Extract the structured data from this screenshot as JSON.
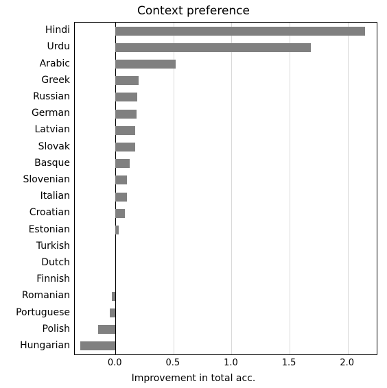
{
  "chart_data": {
    "type": "bar",
    "orientation": "horizontal",
    "title": "Context preference",
    "xlabel": "Improvement in total acc.",
    "ylabel": "",
    "xlim": [
      -0.35,
      2.25
    ],
    "xticks": [
      0.0,
      0.5,
      1.0,
      1.5,
      2.0
    ],
    "categories": [
      "Hindi",
      "Urdu",
      "Arabic",
      "Greek",
      "Russian",
      "German",
      "Latvian",
      "Slovak",
      "Basque",
      "Slovenian",
      "Italian",
      "Croatian",
      "Estonian",
      "Turkish",
      "Dutch",
      "Finnish",
      "Romanian",
      "Portuguese",
      "Polish",
      "Hungarian"
    ],
    "values": [
      2.15,
      1.68,
      0.52,
      0.2,
      0.19,
      0.18,
      0.17,
      0.17,
      0.12,
      0.1,
      0.1,
      0.08,
      0.03,
      0.0,
      0.0,
      0.0,
      -0.03,
      -0.05,
      -0.15,
      -0.3
    ]
  }
}
